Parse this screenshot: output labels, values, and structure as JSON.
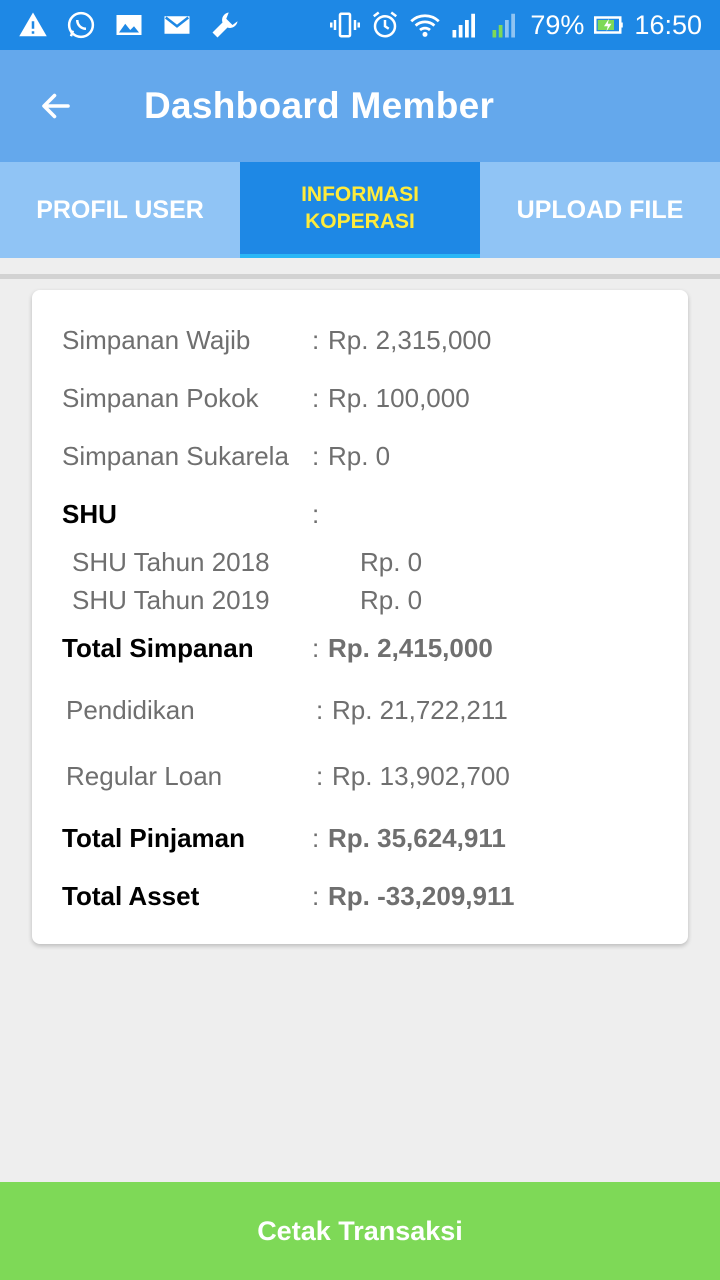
{
  "status_bar": {
    "battery": "79%",
    "time": "16:50",
    "left_icons": [
      "warning-icon",
      "whatsapp-icon",
      "image-icon",
      "mail-icon",
      "wrench-icon"
    ],
    "right_icons": [
      "vibrate-icon",
      "alarm-icon",
      "wifi-icon",
      "signal-sim1-icon",
      "signal-sim2-icon",
      "battery-charging-icon"
    ]
  },
  "app_bar": {
    "title": "Dashboard Member",
    "back_icon": "arrow-back-icon"
  },
  "tabs": [
    {
      "label": "PROFIL USER",
      "active": false
    },
    {
      "label_line1": "INFORMASI",
      "label_line2": "KOPERASI",
      "active": true
    },
    {
      "label": "UPLOAD FILE",
      "active": false
    }
  ],
  "info": {
    "simpanan_wajib": {
      "label": "Simpanan Wajib",
      "colon": ":",
      "value": "Rp. 2,315,000"
    },
    "simpanan_pokok": {
      "label": "Simpanan Pokok",
      "colon": ":",
      "value": "Rp. 100,000"
    },
    "simpanan_sukarela": {
      "label": "Simpanan Sukarela",
      "colon": ":",
      "value": "Rp. 0"
    },
    "shu": {
      "label": "SHU",
      "colon": ":"
    },
    "shu_2018": {
      "label": "SHU Tahun 2018",
      "value": "Rp. 0"
    },
    "shu_2019": {
      "label": "SHU Tahun 2019",
      "value": "Rp. 0"
    },
    "total_simpanan": {
      "label": "Total Simpanan",
      "colon": ":",
      "value": "Rp. 2,415,000"
    },
    "pendidikan": {
      "label": "Pendidikan",
      "colon": ":",
      "value": "Rp. 21,722,211"
    },
    "regular_loan": {
      "label": "Regular Loan",
      "colon": ":",
      "value": "Rp. 13,902,700"
    },
    "total_pinjaman": {
      "label": "Total Pinjaman",
      "colon": ":",
      "value": "Rp. 35,624,911"
    },
    "total_asset": {
      "label": "Total Asset",
      "colon": ":",
      "value": "Rp. -33,209,911"
    }
  },
  "bottom_button": {
    "label": "Cetak Transaksi"
  },
  "colors": {
    "status_bar": "#1e88e5",
    "app_bar": "#64a8ec",
    "tabs": "#90c4f5",
    "active_tab": "#1e88e5",
    "active_tab_text": "#ffeb3b",
    "button": "#7ed957"
  }
}
